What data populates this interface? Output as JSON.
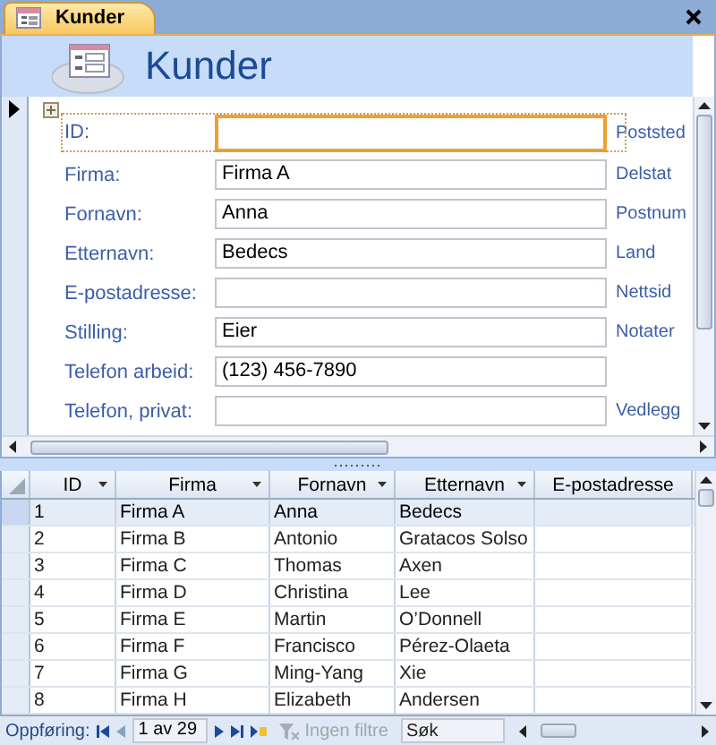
{
  "document_tab": {
    "title": "Kunder",
    "selected": true
  },
  "form": {
    "title": "Kunder",
    "fields": [
      {
        "label": "ID:",
        "focused": true,
        "side_label": "Poststed"
      },
      {
        "label": "Firma:",
        "value": "Firma A",
        "focused": false,
        "side_label": "Delstat"
      },
      {
        "label": "Fornavn:",
        "value": "Anna",
        "focused": false,
        "side_label": "Postnum"
      },
      {
        "label": "Etternavn:",
        "value": "Bedecs",
        "focused": false,
        "side_label": "Land"
      },
      {
        "label": "E-postadresse:",
        "focused": false,
        "side_label": "Nettsid"
      },
      {
        "label": "Stilling:",
        "value": "Eier",
        "focused": false,
        "side_label": "Notater"
      },
      {
        "label": "Telefon arbeid:",
        "value": "(123) 456-7890",
        "focused": false
      },
      {
        "label": "Telefon, privat:",
        "focused": false,
        "side_label": "Vedlegg"
      }
    ]
  },
  "datasheet": {
    "columns": [
      {
        "label": "ID",
        "dropdown": true
      },
      {
        "label": "Firma",
        "dropdown": true
      },
      {
        "label": "Fornavn",
        "dropdown": true
      },
      {
        "label": "Etternavn",
        "dropdown": true
      },
      {
        "label": "E-postadresse",
        "dropdown": false
      }
    ],
    "rows": [
      {
        "cells": [
          "1",
          "Firma A",
          "Anna",
          "Bedecs"
        ],
        "selected": true
      },
      {
        "cells": [
          "2",
          "Firma B",
          "Antonio",
          "Gratacos Solso"
        ],
        "selected": false
      },
      {
        "cells": [
          "3",
          "Firma C",
          "Thomas",
          "Axen"
        ],
        "selected": false
      },
      {
        "cells": [
          "4",
          "Firma D",
          "Christina",
          "Lee"
        ],
        "selected": false
      },
      {
        "cells": [
          "5",
          "Firma E",
          "Martin",
          "O’Donnell"
        ],
        "selected": false
      },
      {
        "cells": [
          "6",
          "Firma F",
          "Francisco",
          "Pérez-Olaeta"
        ],
        "selected": false
      },
      {
        "cells": [
          "7",
          "Firma G",
          "Ming-Yang",
          "Xie"
        ],
        "selected": false
      },
      {
        "cells": [
          "8",
          "Firma H",
          "Elizabeth",
          "Andersen"
        ],
        "selected": false
      }
    ]
  },
  "navigation": {
    "label": "Oppføring:",
    "record": "1 av 29",
    "filter": {
      "label": "Ingen filtre",
      "disabled": true
    },
    "search": {
      "placeholder": "Søk"
    }
  }
}
